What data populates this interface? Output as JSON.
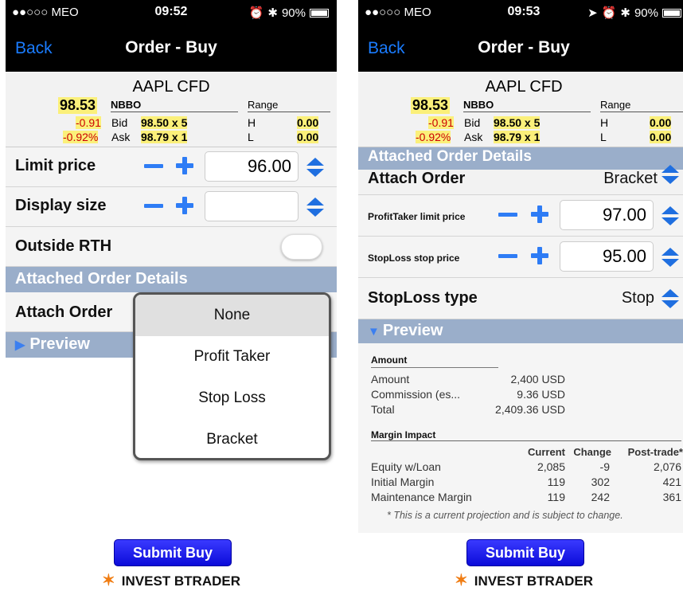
{
  "status_left": {
    "carrier": "●●○○○ MEO",
    "time": "09:52",
    "battery": "90%"
  },
  "status_right": {
    "carrier": "●●○○○ MEO",
    "time": "09:53",
    "battery": "90%"
  },
  "nav": {
    "back": "Back",
    "title": "Order - Buy"
  },
  "quote": {
    "symbol": "AAPL CFD",
    "last": "98.53",
    "nbbo": "NBBO",
    "range": "Range",
    "change": "-0.91",
    "change_pct": "-0.92%",
    "bid_label": "Bid",
    "bid": "98.50 x 5",
    "ask_label": "Ask",
    "ask": "98.79 x 1",
    "high_label": "H",
    "high": "0.00",
    "low_label": "L",
    "low": "0.00"
  },
  "left": {
    "limit_label": "Limit price",
    "limit_value": "96.00",
    "display_label": "Display size",
    "display_value": "",
    "rth_label": "Outside RTH",
    "section": "Attached Order Details",
    "attach_label": "Attach Order",
    "preview": "Preview",
    "options": [
      "None",
      "Profit Taker",
      "Stop Loss",
      "Bracket"
    ],
    "selected_option": "None",
    "submit": "Submit Buy"
  },
  "right": {
    "section": "Attached Order Details",
    "attach_label": "Attach Order",
    "attach_value": "Bracket",
    "pt_label": "ProfitTaker limit price",
    "pt_value": "97.00",
    "sl_label": "StopLoss stop price",
    "sl_value": "95.00",
    "sltype_label": "StopLoss type",
    "sltype_value": "Stop",
    "preview": "Preview",
    "amount_header": "Amount",
    "amount_rows": [
      {
        "label": "Amount",
        "value": "2,400 USD"
      },
      {
        "label": "Commission (es...",
        "value": "9.36 USD"
      },
      {
        "label": "Total",
        "value": "2,409.36 USD"
      }
    ],
    "margin_header": "Margin Impact",
    "margin_cols": [
      "Current",
      "Change",
      "Post-trade*"
    ],
    "margin_rows": [
      {
        "label": "Equity w/Loan",
        "current": "2,085",
        "change": "-9",
        "post": "2,076"
      },
      {
        "label": "Initial Margin",
        "current": "119",
        "change": "302",
        "post": "421"
      },
      {
        "label": "Maintenance Margin",
        "current": "119",
        "change": "242",
        "post": "361"
      }
    ],
    "footnote": "* This is a current projection and is subject to change.",
    "submit": "Submit Buy"
  },
  "brand": "INVEST BTRADER",
  "colors": {
    "accent": "#2e7cf5",
    "section": "#9aaeca",
    "highlight": "#fbf07a",
    "negative": "#cc0000",
    "submit": "#1515e8",
    "brand_star": "#f07c12"
  }
}
